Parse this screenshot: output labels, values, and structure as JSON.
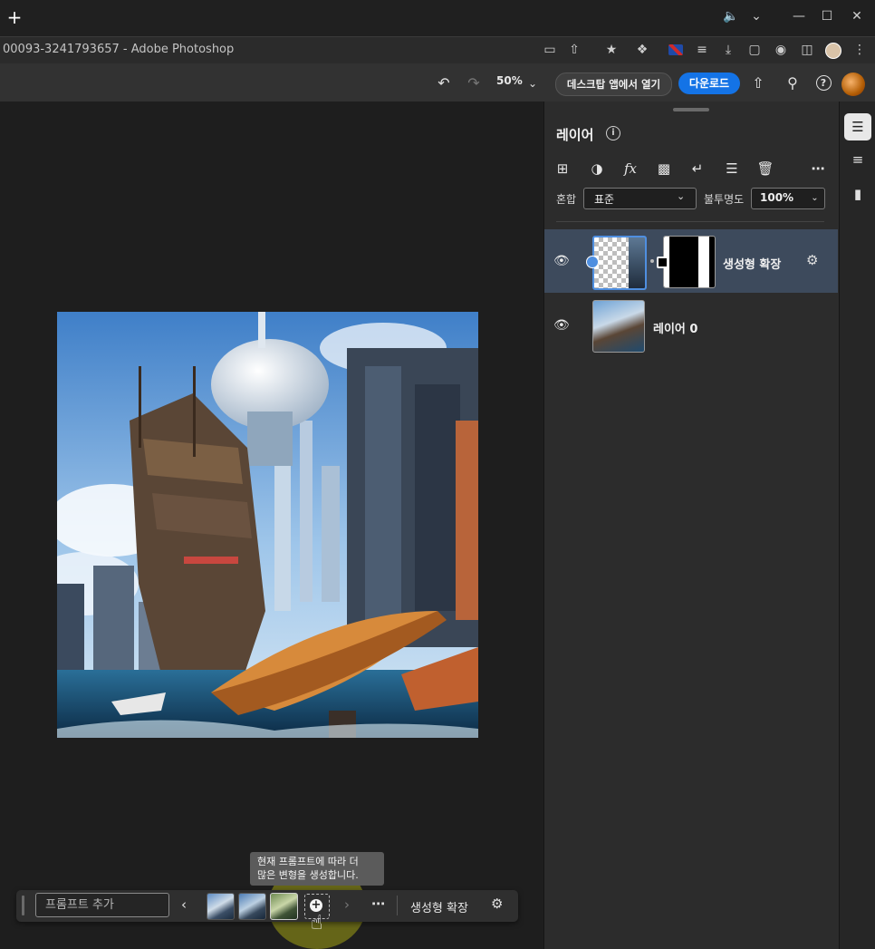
{
  "browser": {
    "page_title": "00093-3241793657 - Adobe Photoshop",
    "new_tab_symbol": "+"
  },
  "toolbar": {
    "zoom": "50%",
    "desktop_button": "데스크탑 앱에서 열기",
    "download_button": "다운로드"
  },
  "layers_panel": {
    "title": "레이어",
    "blend_label": "혼합",
    "blend_value": "표준",
    "opacity_label": "불투명도",
    "opacity_value": "100%",
    "layers": [
      {
        "name": "생성형 확장",
        "selected": true,
        "visible": true
      },
      {
        "name": "레이어 0",
        "selected": false,
        "visible": true
      }
    ]
  },
  "context_bar": {
    "prompt_placeholder": "프롬프트 추가",
    "tooltip_line1": "현재 프롬프트에 따라 더",
    "tooltip_line2": "많은 변형을 생성합니다.",
    "feature_label": "생성형 확장"
  },
  "colors": {
    "accent": "#1473e6",
    "selected_layer": "#3d4a5c",
    "panel_bg": "#2c2c2c",
    "canvas_bg": "#1e1e1e"
  }
}
